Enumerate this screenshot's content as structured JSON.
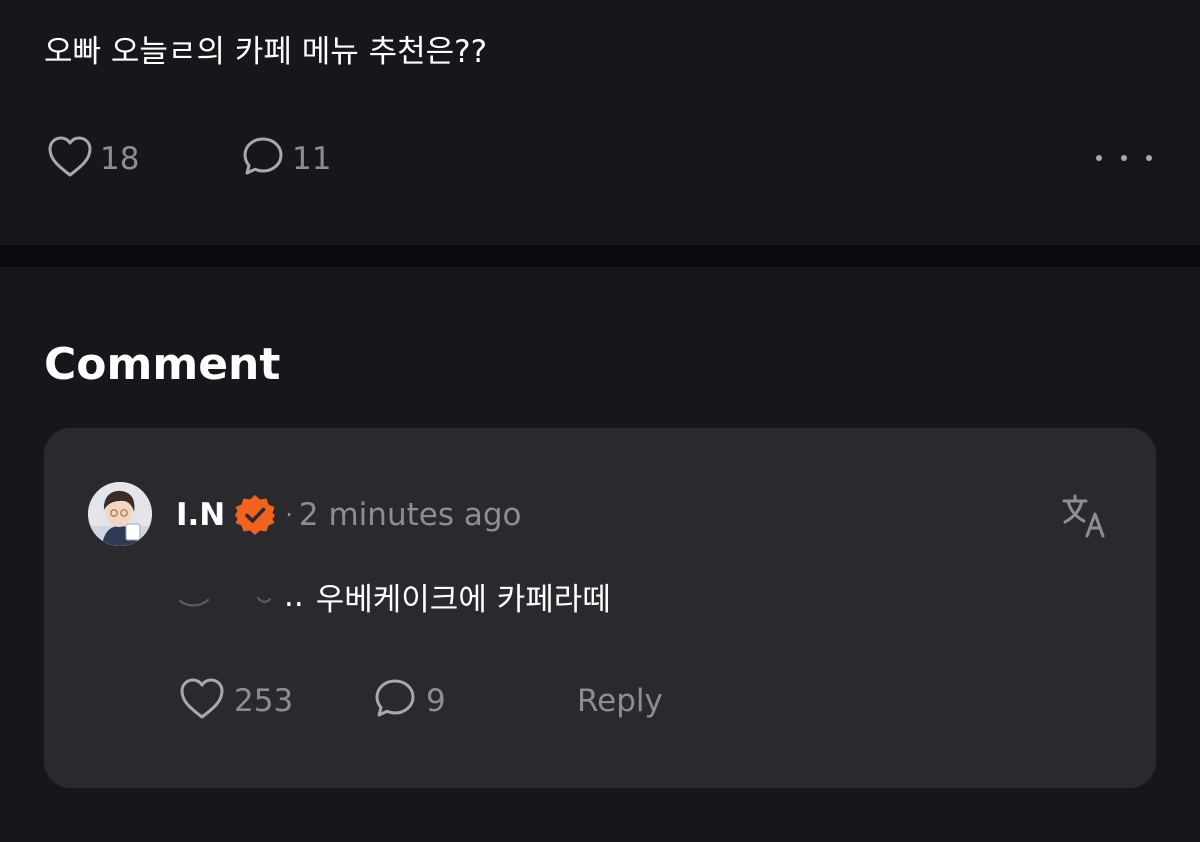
{
  "post": {
    "text": "오빠 오늘ㄹ의 카페 메뉴 추천은??",
    "likes": "18",
    "comments": "11",
    "more_icon": "more-horizontal-icon"
  },
  "comments_section": {
    "heading": "Comment",
    "comment": {
      "author": "I.N",
      "badge_icon": "verified-badge-icon",
      "badge_color": "#f2621f",
      "separator": "·",
      "time": "2 minutes ago",
      "text_prefix": "..",
      "text": "우베케이크에 카페라떼",
      "likes": "253",
      "replies": "9",
      "reply_label": "Reply",
      "translate_icon": "translate-icon"
    }
  },
  "colors": {
    "background": "#17161b",
    "card": "#2a292e",
    "divider": "#0b0b0d",
    "muted_text": "#8e8d92"
  }
}
